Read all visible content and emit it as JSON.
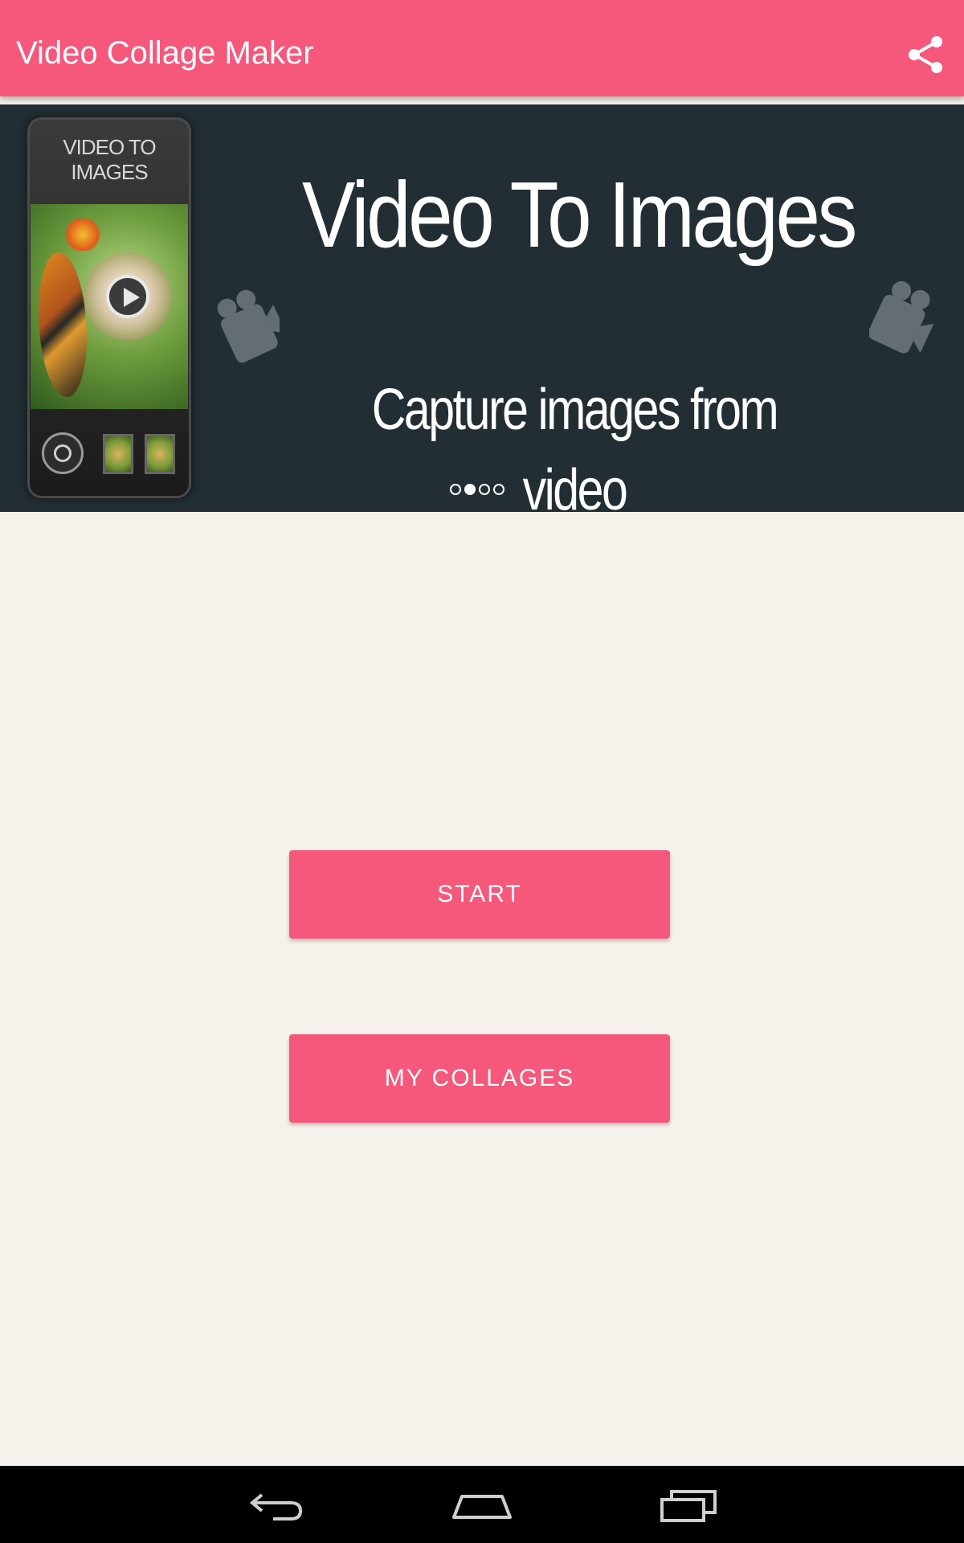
{
  "app_bar": {
    "title": "Video Collage Maker",
    "share_icon": "share-icon",
    "color": "#f5587b"
  },
  "banner": {
    "phone_label": "VIDEO TO IMAGES",
    "title": "Video To Images",
    "subtitle": "Capture images from video",
    "background": "#222e33",
    "pager": {
      "count": 4,
      "active_index": 1
    }
  },
  "actions": {
    "start_label": "START",
    "my_collages_label": "MY COLLAGES"
  },
  "nav_bar": {
    "back_icon": "back-icon",
    "home_icon": "home-icon",
    "recents_icon": "recents-icon"
  },
  "colors": {
    "accent": "#f5587b",
    "page_background": "#f6f1ea",
    "nav_background": "#000000"
  }
}
